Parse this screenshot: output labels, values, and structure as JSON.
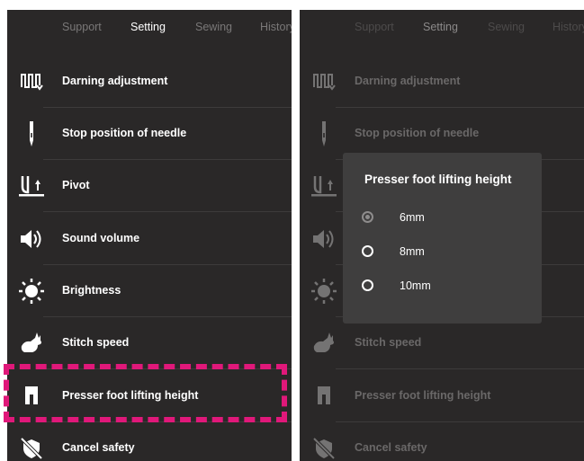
{
  "tabs": [
    "Support",
    "Setting",
    "Sewing",
    "History"
  ],
  "active_tab": "Setting",
  "menu_items": [
    {
      "label": "Darning adjustment",
      "icon": "darning-icon"
    },
    {
      "label": "Stop position of needle",
      "icon": "needle-icon"
    },
    {
      "label": "Pivot",
      "icon": "pivot-icon"
    },
    {
      "label": "Sound volume",
      "icon": "speaker-icon"
    },
    {
      "label": "Brightness",
      "icon": "sun-icon"
    },
    {
      "label": "Stitch speed",
      "icon": "rabbit-icon"
    },
    {
      "label": "Presser foot lifting height",
      "icon": "presser-foot-icon"
    },
    {
      "label": "Cancel safety",
      "icon": "cancel-safety-icon"
    }
  ],
  "highlighted_item": "Presser foot lifting height",
  "dialog": {
    "title": "Presser foot lifting height",
    "options": [
      "6mm",
      "8mm",
      "10mm"
    ],
    "selected": "6mm"
  },
  "colors": {
    "background": "#2a2828",
    "dialog": "#3f3e3e",
    "highlight": "#e0187a"
  }
}
